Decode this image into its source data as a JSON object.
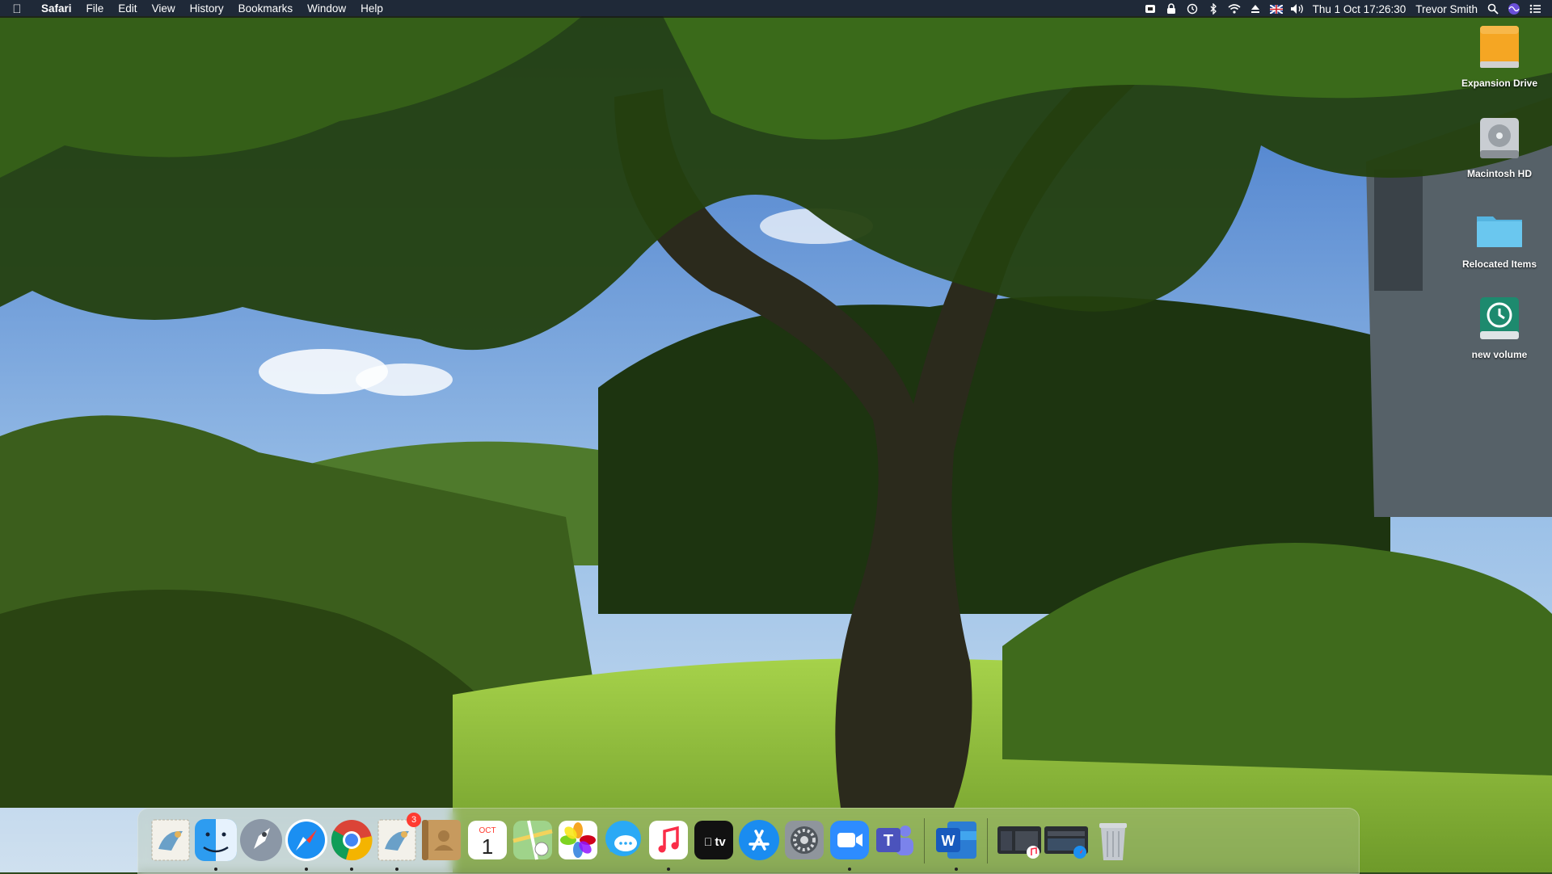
{
  "menubar": {
    "app_name": "Safari",
    "menus": [
      "File",
      "Edit",
      "View",
      "History",
      "Bookmarks",
      "Window",
      "Help"
    ],
    "clock": "Thu 1 Oct  17:26:30",
    "user": "Trevor Smith"
  },
  "desktop": {
    "icons": [
      {
        "label": "Expansion Drive",
        "icon": "external-drive-icon"
      },
      {
        "label": "Macintosh HD",
        "icon": "hard-disk-icon"
      },
      {
        "label": "Relocated Items",
        "icon": "folder-icon"
      },
      {
        "label": "new volume",
        "icon": "time-machine-drive-icon"
      }
    ]
  },
  "dock": {
    "apps": [
      {
        "name": "Mail (dragging)",
        "icon": "mail-stamp-icon"
      },
      {
        "name": "Finder",
        "icon": "finder-icon",
        "running": true
      },
      {
        "name": "Launchpad",
        "icon": "launchpad-icon"
      },
      {
        "name": "Safari",
        "icon": "safari-icon",
        "running": true
      },
      {
        "name": "Google Chrome",
        "icon": "chrome-icon",
        "running": true
      },
      {
        "name": "Mail",
        "icon": "mail-stamp-icon",
        "badge": "3",
        "running": true
      },
      {
        "name": "Contacts",
        "icon": "contacts-icon"
      },
      {
        "name": "Calendar",
        "icon": "calendar-icon",
        "month": "OCT",
        "day": "1"
      },
      {
        "name": "Maps",
        "icon": "maps-icon"
      },
      {
        "name": "Photos",
        "icon": "photos-icon"
      },
      {
        "name": "Messages",
        "icon": "messages-icon"
      },
      {
        "name": "Music",
        "icon": "music-icon",
        "running": true
      },
      {
        "name": "TV",
        "icon": "apple-tv-icon",
        "tv_label": "tv"
      },
      {
        "name": "App Store",
        "icon": "app-store-icon"
      },
      {
        "name": "System Preferences",
        "icon": "system-preferences-icon"
      },
      {
        "name": "Zoom",
        "icon": "zoom-icon",
        "running": true
      },
      {
        "name": "Microsoft Teams",
        "icon": "teams-icon",
        "teams_label": "T"
      },
      {
        "name": "Microsoft Word",
        "icon": "word-icon",
        "word_label": "W",
        "running": true
      },
      {
        "name": "Music window",
        "icon": "minimized-window-icon"
      },
      {
        "name": "Safari window",
        "icon": "minimized-window-icon"
      },
      {
        "name": "Trash",
        "icon": "trash-icon"
      }
    ]
  },
  "colors": {
    "sky": "#6fa0dc",
    "grass": "#8cc43a",
    "foliage": "#2f4a16"
  }
}
